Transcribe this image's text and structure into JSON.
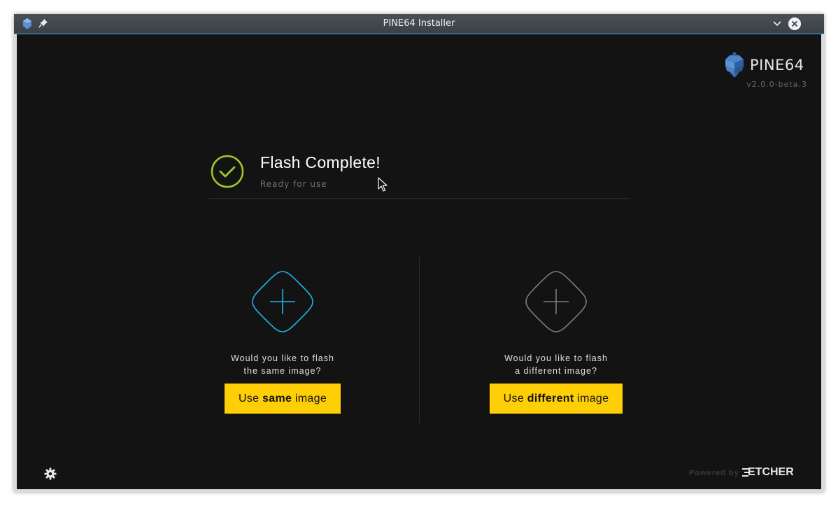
{
  "window": {
    "title": "PINE64 Installer"
  },
  "brand": {
    "name": "PINE64",
    "version": "v2.0.0-beta.3"
  },
  "status": {
    "heading": "Flash Complete!",
    "subheading": "Ready for use"
  },
  "options": [
    {
      "question_line1": "Would you like to flash",
      "question_line2": "the same image?",
      "button_prefix": "Use ",
      "button_bold": "same",
      "button_suffix": " image",
      "accent": "#1fb4e6"
    },
    {
      "question_line1": "Would you like to flash",
      "question_line2": "a different image?",
      "button_prefix": "Use ",
      "button_bold": "different",
      "button_suffix": " image",
      "accent": "#7b7b7b"
    }
  ],
  "footer": {
    "powered_by": "Powered by",
    "etcher_label": "ETCHER"
  },
  "colors": {
    "background": "#141314",
    "button": "#fecf06",
    "success": "#9fc928",
    "titlebar": "#40454b",
    "focus_line": "#3daee9"
  },
  "icons": [
    "app-icon",
    "pin-icon",
    "chevron-down-icon",
    "close-icon",
    "pine64-logo-icon",
    "check-circle-icon",
    "plus-icon",
    "gear-icon",
    "etcher-logo-icon",
    "mouse-cursor-icon"
  ]
}
